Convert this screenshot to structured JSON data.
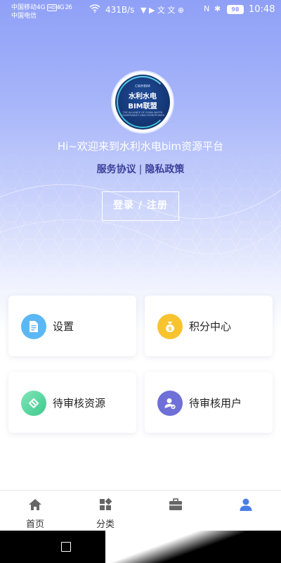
{
  "status_bar": {
    "carrier1": "中国移动4G",
    "carrier1_badge": "HD",
    "carrier2": "中国电信",
    "signal": "4G 26",
    "speed": "431B/s",
    "apps": "▼ ▶ 文 文 ⊕",
    "nfc": "N",
    "bluetooth": "✱",
    "battery": "98",
    "time": "10:48"
  },
  "logo": {
    "small_text": "CWHBIM",
    "line1": "水利水电",
    "line2": "BIM联盟",
    "tiny_text": "THE ALLIANCE OF CHINA WATER CONSERVANCY AND HYDROPOWER"
  },
  "welcome": "Hi~欢迎来到水利水电bim资源平台",
  "links": {
    "service": "服务协议",
    "separator": "|",
    "privacy": "隐私政策"
  },
  "login_button": "登录 / 注册",
  "cards": {
    "settings": {
      "label": "设置",
      "icon": "document-icon",
      "color": "#5bb8f5"
    },
    "points": {
      "label": "积分中心",
      "icon": "money-bag-icon",
      "color": "#f7c32f"
    },
    "resources": {
      "label": "待审核资源",
      "icon": "link-icon",
      "color": "#4fd3a0"
    },
    "users": {
      "label": "待审核用户",
      "icon": "user-check-icon",
      "color": "#6f6fd8"
    }
  },
  "bottom_nav": {
    "home": {
      "label": "首页",
      "icon": "home-icon"
    },
    "category": {
      "label": "分类",
      "icon": "grid-icon"
    },
    "work": {
      "label": "",
      "icon": "briefcase-icon"
    },
    "profile": {
      "label": "",
      "icon": "user-icon",
      "active_color": "#4a7de6"
    }
  }
}
